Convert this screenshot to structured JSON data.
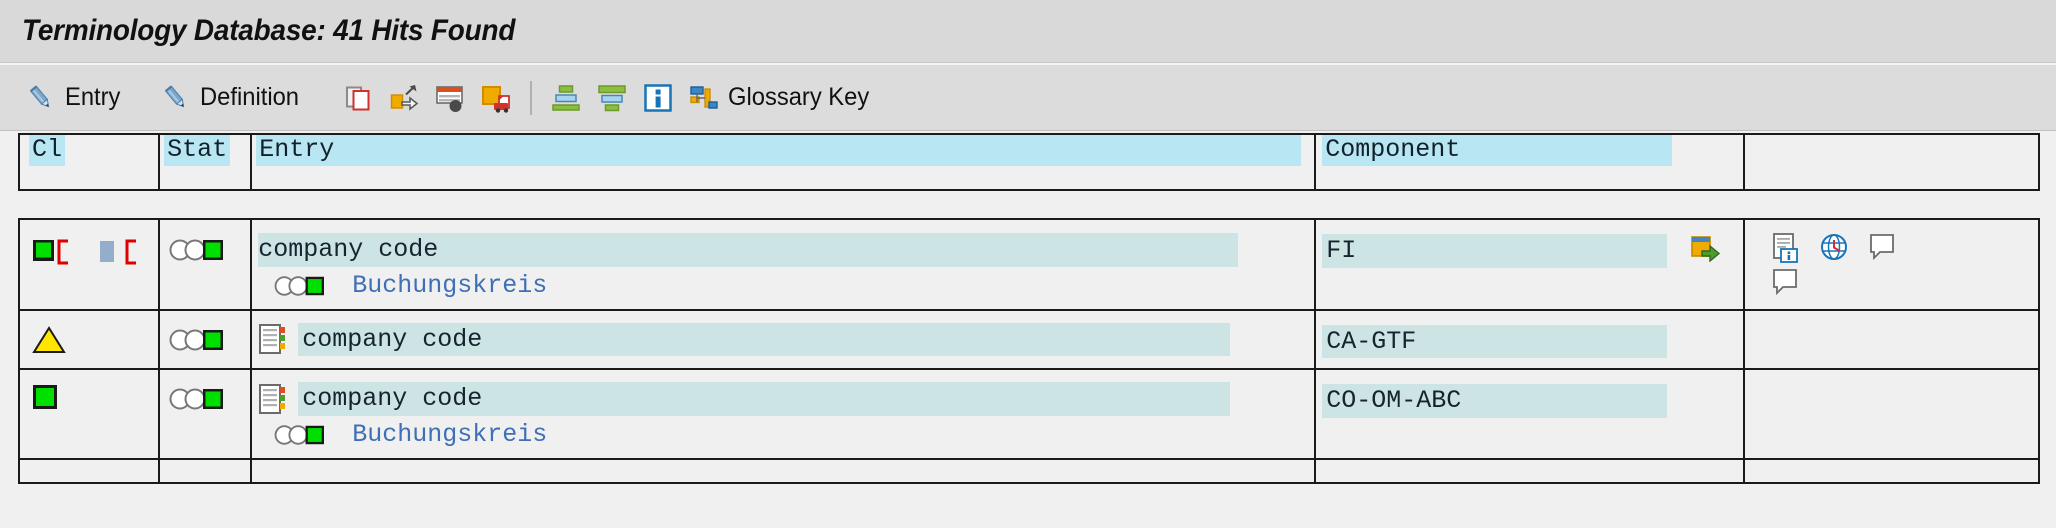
{
  "window": {
    "title": "Terminology Database: 41 Hits Found"
  },
  "toolbar": {
    "buttons": [
      {
        "id": "entry",
        "label": "Entry",
        "icon": "pencil-icon"
      },
      {
        "id": "definition",
        "label": "Definition",
        "icon": "pencil-icon"
      }
    ],
    "icon_buttons": [
      {
        "id": "copy",
        "icon": "copy-document-icon"
      },
      {
        "id": "export",
        "icon": "export-arrow-icon"
      },
      {
        "id": "list-detail",
        "icon": "list-detail-icon"
      },
      {
        "id": "print-preview",
        "icon": "print-preview-icon"
      }
    ],
    "icon_buttons_2": [
      {
        "id": "sort-ascending",
        "icon": "sort-ascending-icon"
      },
      {
        "id": "sort-descending",
        "icon": "sort-descending-icon"
      },
      {
        "id": "information",
        "icon": "information-icon"
      }
    ],
    "glossary_key": {
      "id": "glossary-key",
      "label": "Glossary Key",
      "icon": "hierarchy-icon"
    }
  },
  "table": {
    "columns": [
      {
        "key": "cl",
        "label": "Cl"
      },
      {
        "key": "stat",
        "label": "Stat"
      },
      {
        "key": "entry",
        "label": "Entry"
      },
      {
        "key": "component",
        "label": "Component"
      },
      {
        "key": "actions",
        "label": ""
      }
    ],
    "rows": [
      {
        "cl_icons": [
          "green-square-bracket-icon",
          "blue-bar-bracket-icon"
        ],
        "stat_icon": "status-three-circles-green-icon",
        "entry": "company code",
        "entry_prefix_icon": "",
        "sub_entry": "Buchungskreis",
        "sub_entry_icon": "status-three-circles-green-icon",
        "component": "FI",
        "component_jump_icon": "jump-to-icon",
        "actions": [
          "document-info-icon",
          "globe-clock-icon",
          "note-icon",
          "note-corner-icon"
        ]
      },
      {
        "cl_icons": [
          "warning-triangle-icon"
        ],
        "stat_icon": "status-three-circles-green-icon",
        "entry": "company code",
        "entry_prefix_icon": "document-list-icon",
        "sub_entry": "",
        "sub_entry_icon": "",
        "component": "CA-GTF",
        "component_jump_icon": "",
        "actions": []
      },
      {
        "cl_icons": [
          "green-square-icon"
        ],
        "stat_icon": "status-three-circles-green-icon",
        "entry": "company code",
        "entry_prefix_icon": "document-list-icon",
        "sub_entry": "Buchungskreis",
        "sub_entry_icon": "status-three-circles-green-icon",
        "component": "CO-OM-ABC",
        "component_jump_icon": "",
        "actions": []
      }
    ]
  },
  "colors": {
    "title_bar": "#d9d9d9",
    "toolbar": "#dcdcdc",
    "page_bg": "#f0f0f0",
    "header_highlight": "#b8e6f2",
    "cell_highlight": "#cde4e4",
    "link": "#3f6fb5",
    "status_green": "#00e000",
    "warning_yellow": "#ffe500",
    "grid_line": "#1a1a1a"
  }
}
